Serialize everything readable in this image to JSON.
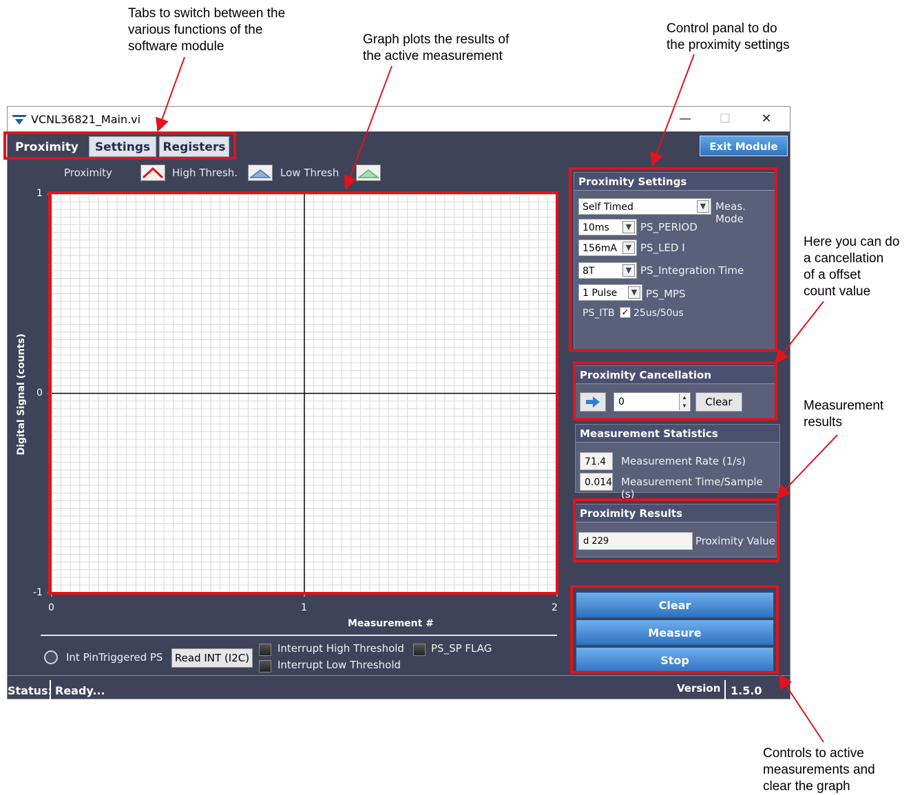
{
  "callouts": {
    "tabs": "Tabs to switch between the\nvarious functions of the\nsoftware module",
    "graph": "Graph plots the results of\nthe active measurement",
    "control": "Control panal to do\nthe proximity settings",
    "cancel": "Here you can do\na cancellation\nof a offset\ncount value",
    "results": "Measurement\nresults",
    "controls": "Controls to active\nmeasurements and\nclear the graph"
  },
  "window": {
    "title": "VCNL36821_Main.vi",
    "minimize": "—",
    "maximize": "☐",
    "close": "✕"
  },
  "tabs": [
    "Proximity",
    "Settings",
    "Registers"
  ],
  "exit_label": "Exit  Module",
  "legend": {
    "proximity": "Proximity",
    "high": "High Thresh.",
    "low": "Low Thresh"
  },
  "chart_data": {
    "type": "line",
    "title": "",
    "xlabel": "Measurement #",
    "ylabel": "Digital Signal  (counts)",
    "xlim": [
      0,
      2
    ],
    "ylim": [
      -1,
      1
    ],
    "x_ticks": [
      "0",
      "1",
      "2"
    ],
    "y_ticks": [
      "1",
      "0",
      "-1"
    ],
    "grid": true,
    "series": []
  },
  "settings": {
    "header": "Proximity Settings",
    "meas_mode_value": "Self Timed",
    "meas_mode_label": "Meas. Mode",
    "period_value": "10ms",
    "period_label": "PS_PERIOD",
    "led_value": "156mA",
    "led_label": "PS_LED I",
    "integ_value": "8T",
    "integ_label": "PS_Integration Time",
    "mps_value": "1 Pulse",
    "mps_label": "PS_MPS",
    "itb_label": "PS_ITB",
    "itb_option": "25us/50us"
  },
  "cancellation": {
    "header": "Proximity Cancellation",
    "value": "0",
    "clear": "Clear"
  },
  "stats": {
    "header": "Measurement Statistics",
    "rate_value": "71.4",
    "rate_label": "Measurement Rate (1/s)",
    "time_value": "0.014",
    "time_label": "Measurement Time/Sample (s)"
  },
  "results": {
    "header": "Proximity Results",
    "value": "d 229",
    "label": "Proximity Value"
  },
  "buttons": {
    "clear": "Clear",
    "measure": "Measure",
    "stop": "Stop"
  },
  "bottom": {
    "int_pin": "Int PinTriggered PS",
    "read_int": "Read INT (I2C)",
    "high_thr": "Interrupt High Threshold",
    "low_thr": "Interrupt Low Threshold",
    "sp_flag": "PS_SP FLAG"
  },
  "status": {
    "label": "Status:",
    "value": "Ready...",
    "version_label": "Version",
    "version_value": "1.5.0"
  },
  "colors": {
    "annotation": "#e3121b",
    "window_bg": "#3e435a",
    "plot_bg": "#ffffff"
  }
}
